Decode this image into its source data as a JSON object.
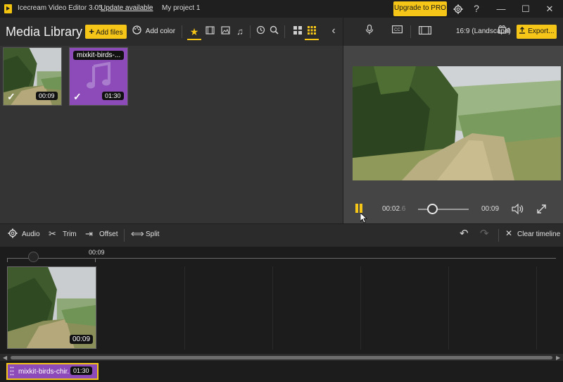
{
  "window": {
    "app_title": "Icecream Video Editor 3.05",
    "separator": "-",
    "update_link": "Update available",
    "project_name": "My project 1",
    "upgrade_label": "Upgrade to PRO",
    "settings_icon": "gear-icon",
    "help_label": "?",
    "minimize": "—",
    "maximize": "☐",
    "close": "✕"
  },
  "library": {
    "title": "Media Library",
    "add_files_label": "Add files",
    "add_color_label": "Add color",
    "items": [
      {
        "type": "video",
        "duration": "00:09"
      },
      {
        "type": "audio",
        "name": "mixkit-birds-...",
        "duration": "01:30"
      }
    ]
  },
  "right_header": {
    "aspect_ratio": "16:9 (Landscape)",
    "export_label": "Export..."
  },
  "player": {
    "current_time_main": "00:02",
    "current_time_frac": ".6",
    "end_time": "00:09",
    "progress": 0.29
  },
  "edit_toolbar": {
    "audio": "Audio",
    "trim": "Trim",
    "offset": "Offset",
    "split": "Split",
    "clear": "Clear timeline"
  },
  "timeline": {
    "ruler_label": "00:09",
    "clip_duration": "00:09",
    "audio_clip_name": "mixkit-birds-chir...",
    "audio_clip_duration": "01:30"
  },
  "colors": {
    "accent": "#f5c518",
    "audio_clip": "#8c4bb8"
  }
}
